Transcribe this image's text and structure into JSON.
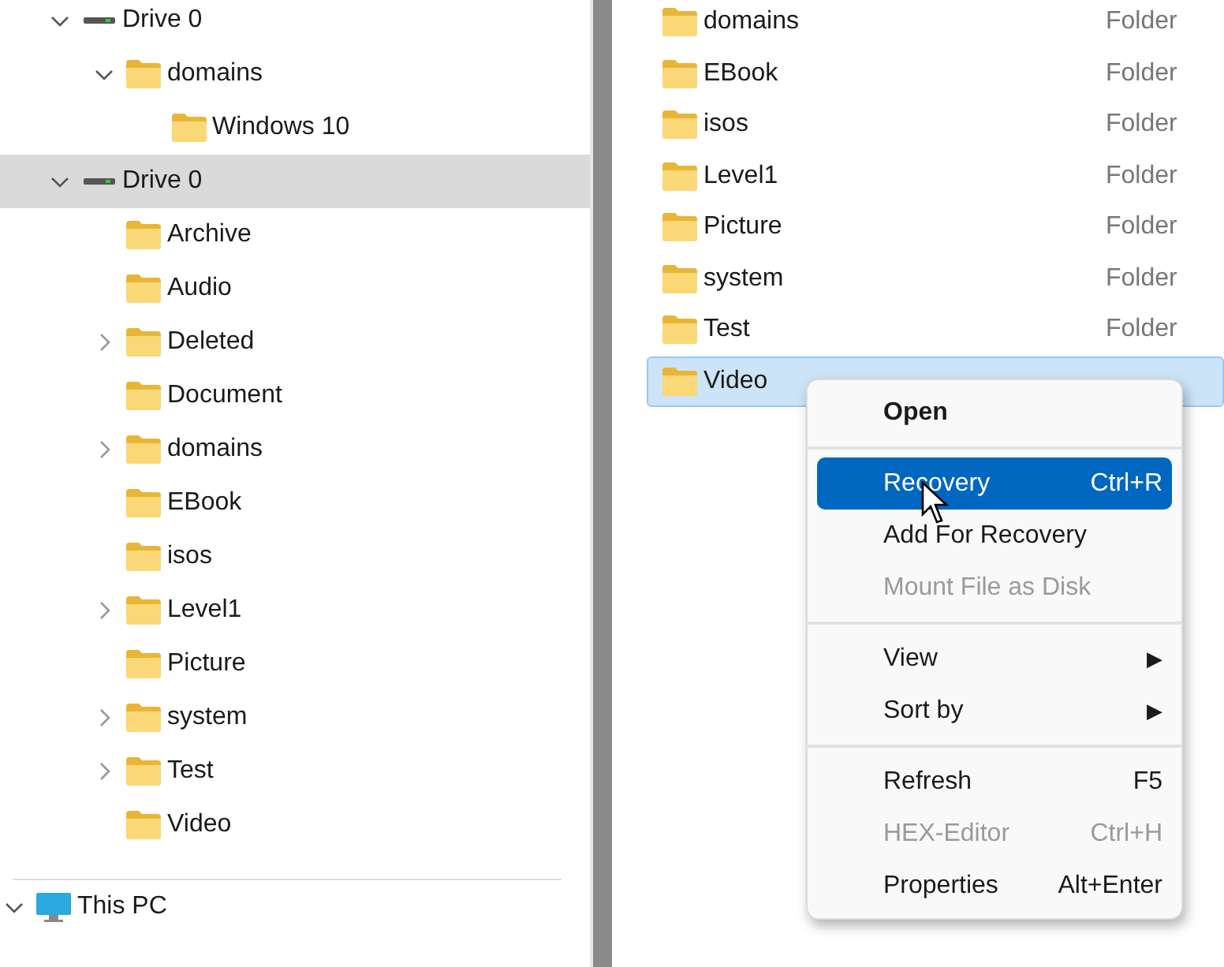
{
  "tree": [
    {
      "label": "Drive 0",
      "kind": "drive",
      "expanded": true,
      "has_children": true,
      "selected": false,
      "children": [
        {
          "label": "domains",
          "kind": "folder",
          "expanded": true,
          "has_children": true,
          "selected": false,
          "children": [
            {
              "label": "Windows 10",
              "kind": "folder",
              "expanded": false,
              "has_children": false,
              "selected": false
            }
          ]
        }
      ]
    },
    {
      "label": "Drive 0",
      "kind": "drive",
      "expanded": true,
      "has_children": true,
      "selected": true,
      "children": [
        {
          "label": "Archive",
          "kind": "folder",
          "expanded": false,
          "has_children": false,
          "selected": false
        },
        {
          "label": "Audio",
          "kind": "folder",
          "expanded": false,
          "has_children": false,
          "selected": false
        },
        {
          "label": "Deleted",
          "kind": "folder",
          "expanded": false,
          "has_children": true,
          "selected": false
        },
        {
          "label": "Document",
          "kind": "folder",
          "expanded": false,
          "has_children": false,
          "selected": false
        },
        {
          "label": "domains",
          "kind": "folder",
          "expanded": false,
          "has_children": true,
          "selected": false
        },
        {
          "label": "EBook",
          "kind": "folder",
          "expanded": false,
          "has_children": false,
          "selected": false
        },
        {
          "label": "isos",
          "kind": "folder",
          "expanded": false,
          "has_children": false,
          "selected": false
        },
        {
          "label": "Level1",
          "kind": "folder",
          "expanded": false,
          "has_children": true,
          "selected": false
        },
        {
          "label": "Picture",
          "kind": "folder",
          "expanded": false,
          "has_children": false,
          "selected": false
        },
        {
          "label": "system",
          "kind": "folder",
          "expanded": false,
          "has_children": true,
          "selected": false
        },
        {
          "label": "Test",
          "kind": "folder",
          "expanded": false,
          "has_children": true,
          "selected": false
        },
        {
          "label": "Video",
          "kind": "folder",
          "expanded": false,
          "has_children": false,
          "selected": false
        }
      ]
    }
  ],
  "this_pc": {
    "label": "This PC",
    "kind": "pc",
    "expanded": true,
    "has_children": true,
    "selected": false
  },
  "files": [
    {
      "name": "domains",
      "type": "Folder",
      "selected": false
    },
    {
      "name": "EBook",
      "type": "Folder",
      "selected": false
    },
    {
      "name": "isos",
      "type": "Folder",
      "selected": false
    },
    {
      "name": "Level1",
      "type": "Folder",
      "selected": false
    },
    {
      "name": "Picture",
      "type": "Folder",
      "selected": false
    },
    {
      "name": "system",
      "type": "Folder",
      "selected": false
    },
    {
      "name": "Test",
      "type": "Folder",
      "selected": false
    },
    {
      "name": "Video",
      "selected": true
    }
  ],
  "context_menu": [
    {
      "kind": "item",
      "label": "Open",
      "bold": true,
      "disabled": false,
      "selected": false
    },
    {
      "kind": "separator"
    },
    {
      "kind": "item",
      "label": "Recovery",
      "shortcut": "Ctrl+R",
      "bold": false,
      "disabled": false,
      "selected": true
    },
    {
      "kind": "item",
      "label": "Add For Recovery",
      "bold": false,
      "disabled": false,
      "selected": false
    },
    {
      "kind": "item",
      "label": "Mount File as Disk",
      "bold": false,
      "disabled": true,
      "selected": false
    },
    {
      "kind": "separator"
    },
    {
      "kind": "item",
      "label": "View",
      "shortcut": "▶",
      "bold": false,
      "disabled": false,
      "selected": false
    },
    {
      "kind": "item",
      "label": "Sort by",
      "shortcut": "▶",
      "bold": false,
      "disabled": false,
      "selected": false
    },
    {
      "kind": "separator"
    },
    {
      "kind": "item",
      "label": "Refresh",
      "shortcut": "F5",
      "bold": false,
      "disabled": false,
      "selected": false
    },
    {
      "kind": "item",
      "label": "HEX-Editor",
      "shortcut": "Ctrl+H",
      "bold": false,
      "disabled": true,
      "selected": false
    },
    {
      "kind": "item",
      "label": "Properties",
      "shortcut": "Alt+Enter",
      "bold": false,
      "disabled": false,
      "selected": false
    }
  ]
}
